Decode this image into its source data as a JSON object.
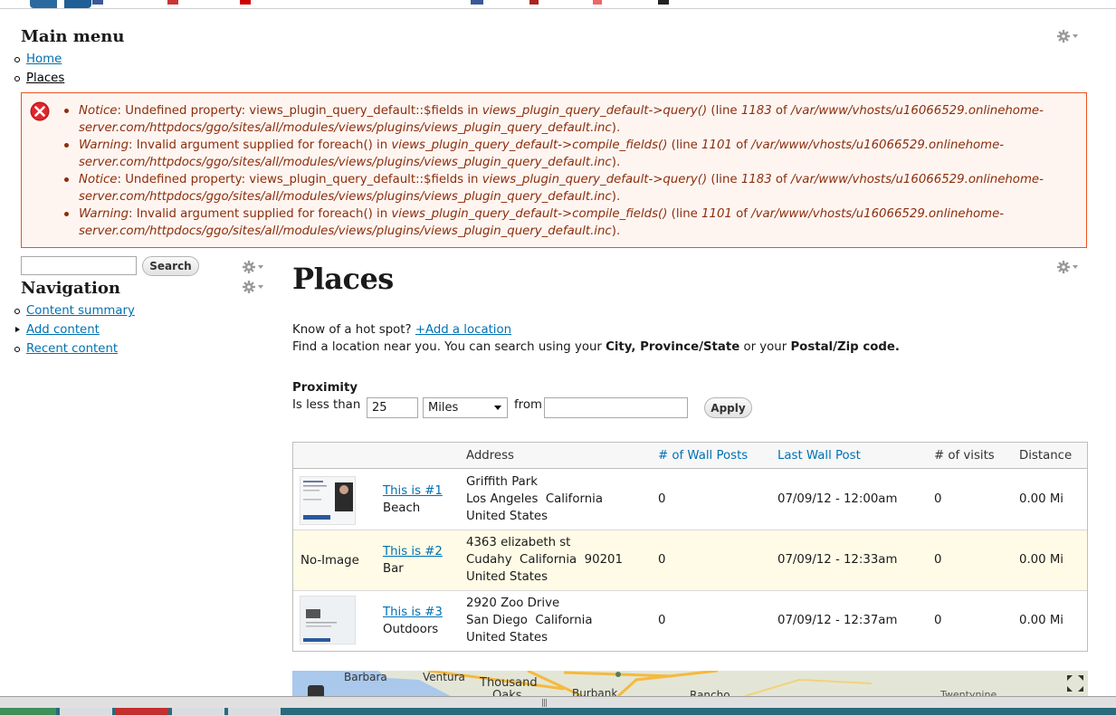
{
  "main_menu": {
    "title": "Main menu",
    "items": [
      {
        "label": "Home"
      },
      {
        "label": "Places"
      }
    ]
  },
  "errors": [
    {
      "type": "Notice",
      "text": ": Undefined property: views_plugin_query_default::$fields in ",
      "func": "views_plugin_query_default->query()",
      "mid": " (line ",
      "line": "1183",
      "of": " of ",
      "path1": "/var/www/vhosts/u16066529.onlinehome-",
      "path2": "server.com/httpdocs/ggo/sites/all/modules/views/plugins/views_plugin_query_default.inc",
      "end": ")."
    },
    {
      "type": "Warning",
      "text": ": Invalid argument supplied for foreach() in ",
      "func": "views_plugin_query_default->compile_fields()",
      "mid": " (line ",
      "line": "1101",
      "of": " of ",
      "path1": "/var/www/vhosts/u16066529.onlinehome-",
      "path2": "server.com/httpdocs/ggo/sites/all/modules/views/plugins/views_plugin_query_default.inc",
      "end": ")."
    },
    {
      "type": "Notice",
      "text": ": Undefined property: views_plugin_query_default::$fields in ",
      "func": "views_plugin_query_default->query()",
      "mid": " (line ",
      "line": "1183",
      "of": " of ",
      "path1": "/var/www/vhosts/u16066529.onlinehome-",
      "path2": "server.com/httpdocs/ggo/sites/all/modules/views/plugins/views_plugin_query_default.inc",
      "end": ")."
    },
    {
      "type": "Warning",
      "text": ": Invalid argument supplied for foreach() in ",
      "func": "views_plugin_query_default->compile_fields()",
      "mid": " (line ",
      "line": "1101",
      "of": " of ",
      "path1": "/var/www/vhosts/u16066529.onlinehome-",
      "path2": "server.com/httpdocs/ggo/sites/all/modules/views/plugins/views_plugin_query_default.inc",
      "end": ")."
    }
  ],
  "search": {
    "button_label": "Search",
    "value": ""
  },
  "navigation": {
    "title": "Navigation",
    "items": [
      {
        "label": "Content summary"
      },
      {
        "label": "Add content"
      },
      {
        "label": "Recent content"
      }
    ]
  },
  "page": {
    "title": "Places",
    "hotspot_prefix": "Know of a hot spot? ",
    "hotspot_link": "+Add a location",
    "find_prefix": "Find a location near you. You can search using your ",
    "find_bold1": "City, Province/State",
    "find_mid": " or your ",
    "find_bold2": "Postal/Zip code."
  },
  "proximity": {
    "label": "Proximity",
    "is_less_than": "Is less than",
    "distance_value": "25",
    "unit_selected": "Miles",
    "from_label": "from",
    "from_value": "",
    "apply_label": "Apply"
  },
  "table": {
    "headers": {
      "address": "Address",
      "wall_posts": "# of Wall Posts",
      "last_wall_post": "Last Wall Post",
      "visits": "# of visits",
      "distance": "Distance"
    },
    "rows": [
      {
        "image": "",
        "title": "This is #1",
        "category": "Beach",
        "addr1": "Griffith Park",
        "addr2": "Los Angeles  California",
        "addr3": "United States",
        "wall_posts": "0",
        "last_post": "07/09/12 - 12:00am",
        "visits": "0",
        "distance": "0.00 Mi"
      },
      {
        "image": "No-Image",
        "title": "This is #2",
        "category": "Bar",
        "addr1": "4363 elizabeth st",
        "addr2": "Cudahy  California  90201",
        "addr3": "United States",
        "wall_posts": "0",
        "last_post": "07/09/12 - 12:33am",
        "visits": "0",
        "distance": "0.00 Mi"
      },
      {
        "image": "",
        "title": "This is #3",
        "category": "Outdoors",
        "addr1": "2920 Zoo Drive",
        "addr2": "San Diego  California",
        "addr3": "United States",
        "wall_posts": "0",
        "last_post": "07/09/12 - 12:37am",
        "visits": "0",
        "distance": "0.00 Mi"
      }
    ]
  },
  "map": {
    "labels": [
      "Barbara",
      "Ventura",
      "Thousand",
      "Oaks",
      "Burbank",
      "Rancho",
      "Twentynine"
    ]
  },
  "colors": {
    "link": "#0071b3",
    "error_border": "#ed541d",
    "error_text": "#8c2e0b",
    "error_bg": "#fef5f1"
  }
}
